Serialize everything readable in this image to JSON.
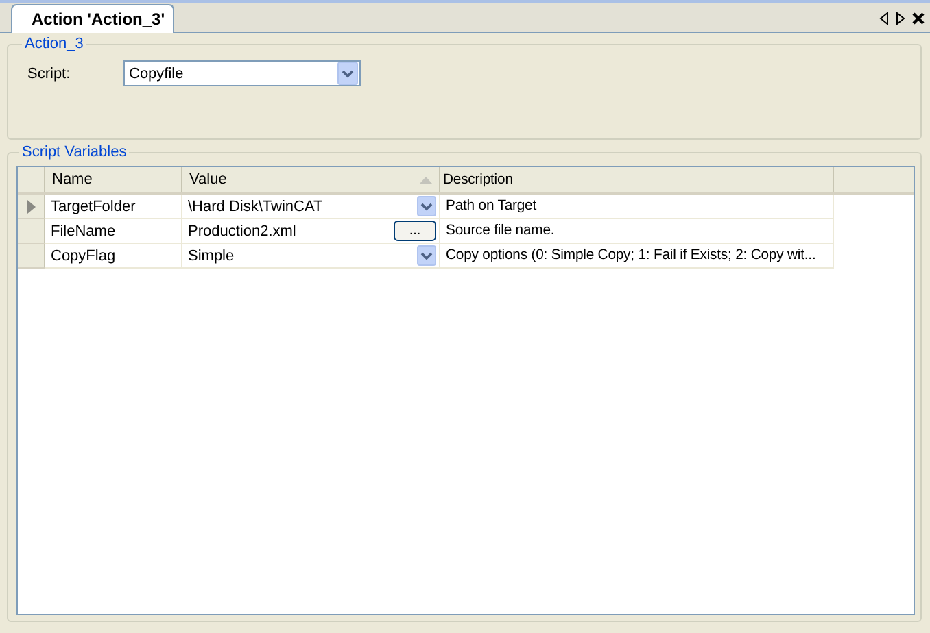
{
  "tabs": [
    {
      "label": "Action 'Action_3'",
      "selected": true
    }
  ],
  "action_group": {
    "title": "Action_3",
    "script_label": "Script:",
    "script_value": "Copyfile"
  },
  "variables_group": {
    "title": "Script Variables",
    "table": {
      "columns": [
        {
          "label": "Name",
          "sorted": false
        },
        {
          "label": "Value",
          "sorted": true
        },
        {
          "label": "Description",
          "sorted": false
        }
      ],
      "rows": [
        {
          "current": true,
          "name": "TargetFolder",
          "value": "\\Hard Disk\\TwinCAT",
          "kind": "dropdown",
          "description": "Path on Target"
        },
        {
          "current": false,
          "name": "FileName",
          "value": "Production2.xml",
          "kind": "ellipsis",
          "button_label": "...",
          "description": "Source file name."
        },
        {
          "current": false,
          "name": "CopyFlag",
          "value": "Simple",
          "kind": "dropdown",
          "description": "Copy options (0: Simple Copy; 1: Fail if Exists; 2: Copy wit..."
        }
      ]
    }
  }
}
